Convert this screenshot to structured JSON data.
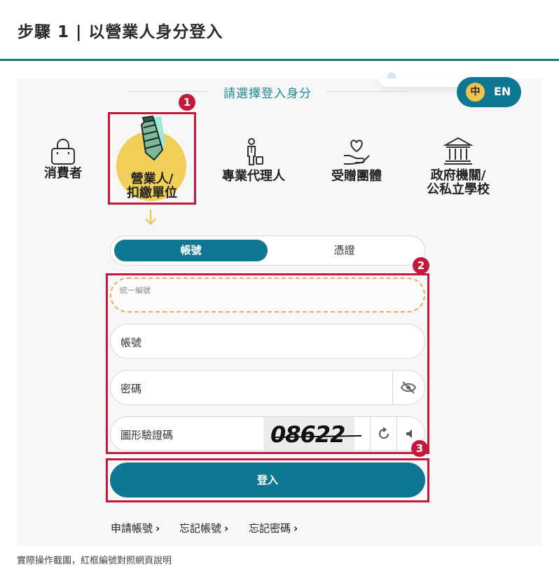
{
  "header": {
    "title": "步驟 1 | 以營業人身分登入"
  },
  "choose_title": "請選擇登入身分",
  "lang": {
    "zh": "中",
    "en": "EN"
  },
  "roles": [
    {
      "label_line1": "消費者",
      "label_line2": ""
    },
    {
      "label_line1": "營業人/",
      "label_line2": "扣繳單位"
    },
    {
      "label_line1": "專業代理人",
      "label_line2": ""
    },
    {
      "label_line1": "受贈團體",
      "label_line2": ""
    },
    {
      "label_line1": "政府機關/",
      "label_line2": "公私立學校"
    }
  ],
  "badges": {
    "one": "1",
    "two": "2",
    "three": "3"
  },
  "tabs": {
    "account": "帳號",
    "certificate": "憑證"
  },
  "fields": {
    "tax_id_placeholder": "統一編號",
    "account": "帳號",
    "password": "密碼",
    "captcha": "圖形驗證碼",
    "captcha_code": "08622"
  },
  "login_label": "登入",
  "links": {
    "apply": "申請帳號",
    "forgot_account": "忘記帳號",
    "forgot_password": "忘記密碼"
  },
  "caption": "實際操作截圖，紅框編號對照網頁說明",
  "colors": {
    "primary": "#0e7893",
    "accent_red": "#c4193a",
    "highlight_yellow": "#f1c24c",
    "dashed_orange": "#f0a85a"
  }
}
